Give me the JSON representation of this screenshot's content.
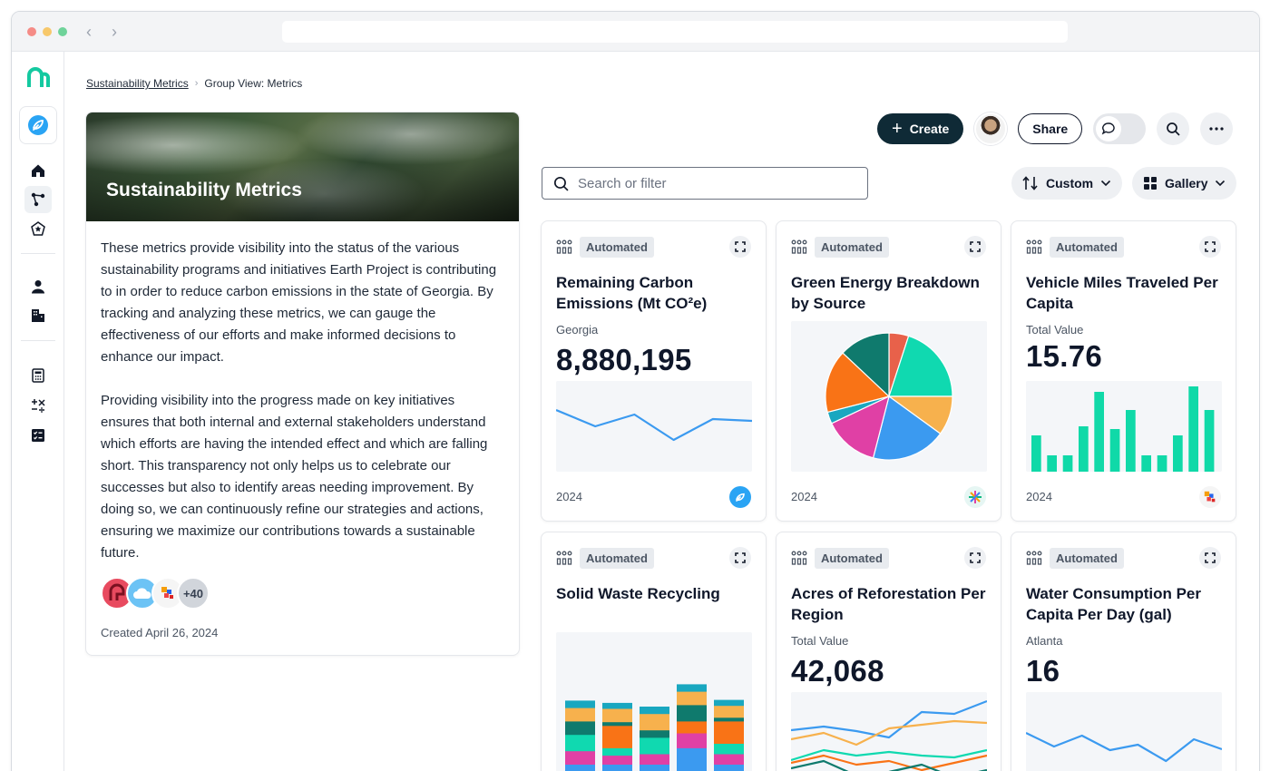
{
  "breadcrumb": {
    "root": "Sustainability Metrics",
    "current": "Group View: Metrics"
  },
  "about": {
    "title": "Sustainability Metrics",
    "paragraph1": "These metrics provide visibility into the status of the various sustainability programs and initiatives Earth Project is contributing to in order to reduce carbon emissions in the state of Georgia. By tracking and analyzing these metrics, we can gauge the effectiveness of our efforts and make informed decisions to enhance our impact.",
    "paragraph2": "Providing visibility into the progress made on key initiatives ensures that both internal and external stakeholders understand which efforts are having the intended effect and which are falling short. This transparency not only helps us to celebrate our successes but also to identify areas needing improvement. By doing so, we can continuously refine our strategies and actions, ensuring we maximize our contributions towards a sustainable future.",
    "more_count": "+40",
    "created": "Created April 26, 2024"
  },
  "toolbar": {
    "create": "Create",
    "share": "Share"
  },
  "search": {
    "placeholder": "Search or filter"
  },
  "sort": {
    "label": "Custom"
  },
  "view": {
    "label": "Gallery"
  },
  "colors": {
    "accent": "#0f2a36",
    "teal": "#10d9a8",
    "blue": "#3b9af0"
  },
  "cards": [
    {
      "badge": "Automated",
      "title": "Remaining Carbon Emissions (Mt CO²e)",
      "subtitle": "Georgia",
      "value": "8,880,195",
      "year": "2024"
    },
    {
      "badge": "Automated",
      "title": "Green Energy Breakdown by Source",
      "year": "2024"
    },
    {
      "badge": "Automated",
      "title": "Vehicle Miles Traveled Per Capita",
      "subtitle": "Total Value",
      "value": "15.76",
      "year": "2024"
    },
    {
      "badge": "Automated",
      "title": "Solid Waste Recycling"
    },
    {
      "badge": "Automated",
      "title": "Acres of Reforestation Per Region",
      "subtitle": "Total Value",
      "value": "42,068"
    },
    {
      "badge": "Automated",
      "title": "Water Consumption  Per Capita Per Day (gal)",
      "subtitle": "Atlanta",
      "value": "16"
    }
  ],
  "chart_data": [
    {
      "type": "line",
      "card": "Remaining Carbon Emissions (Mt CO²e)",
      "series": [
        {
          "color": "#3b9af0",
          "values": [
            68,
            50,
            63,
            35,
            58,
            56
          ]
        }
      ],
      "ylim": [
        0,
        100
      ]
    },
    {
      "type": "pie",
      "card": "Green Energy Breakdown by Source",
      "slices": [
        {
          "value": 5,
          "color": "#e8614a"
        },
        {
          "value": 20,
          "color": "#10d9b0"
        },
        {
          "value": 10,
          "color": "#f7b14d"
        },
        {
          "value": 19,
          "color": "#3b9af0"
        },
        {
          "value": 14,
          "color": "#e040a5"
        },
        {
          "value": 3,
          "color": "#19a7c0"
        },
        {
          "value": 16,
          "color": "#f97316"
        },
        {
          "value": 13,
          "color": "#0f7a6d"
        }
      ]
    },
    {
      "type": "bar",
      "card": "Vehicle Miles Traveled Per Capita",
      "values": [
        40,
        18,
        18,
        50,
        88,
        47,
        68,
        18,
        18,
        40,
        94,
        68
      ],
      "color": "#10d9a8",
      "ylim": [
        0,
        100
      ]
    },
    {
      "type": "bar",
      "stacked": true,
      "card": "Solid Waste Recycling",
      "stacks": [
        [
          {
            "value": 22,
            "color": "#3b9af0"
          },
          {
            "value": 18,
            "color": "#e040a5"
          },
          {
            "value": 22,
            "color": "#10d9b0"
          },
          {
            "value": 18,
            "color": "#0f7a6d"
          },
          {
            "value": 18,
            "color": "#f7b14d"
          },
          {
            "value": 10,
            "color": "#19a7c0"
          }
        ],
        [
          {
            "value": 22,
            "color": "#3b9af0"
          },
          {
            "value": 12,
            "color": "#e040a5"
          },
          {
            "value": 10,
            "color": "#10d9b0"
          },
          {
            "value": 30,
            "color": "#f97316"
          },
          {
            "value": 5,
            "color": "#0f7a6d"
          },
          {
            "value": 18,
            "color": "#f7b14d"
          },
          {
            "value": 8,
            "color": "#19a7c0"
          }
        ],
        [
          {
            "value": 22,
            "color": "#3b9af0"
          },
          {
            "value": 14,
            "color": "#e040a5"
          },
          {
            "value": 22,
            "color": "#10d9b0"
          },
          {
            "value": 10,
            "color": "#0f7a6d"
          },
          {
            "value": 22,
            "color": "#f7b14d"
          },
          {
            "value": 10,
            "color": "#19a7c0"
          }
        ],
        [
          {
            "value": 44,
            "color": "#3b9af0"
          },
          {
            "value": 20,
            "color": "#e040a5"
          },
          {
            "value": 16,
            "color": "#f97316"
          },
          {
            "value": 22,
            "color": "#0f7a6d"
          },
          {
            "value": 18,
            "color": "#f7b14d"
          },
          {
            "value": 10,
            "color": "#19a7c0"
          }
        ],
        [
          {
            "value": 22,
            "color": "#3b9af0"
          },
          {
            "value": 14,
            "color": "#e040a5"
          },
          {
            "value": 14,
            "color": "#10d9b0"
          },
          {
            "value": 30,
            "color": "#f97316"
          },
          {
            "value": 5,
            "color": "#0f7a6d"
          },
          {
            "value": 16,
            "color": "#f7b14d"
          },
          {
            "value": 8,
            "color": "#19a7c0"
          }
        ]
      ]
    },
    {
      "type": "line",
      "card": "Acres of Reforestation Per Region",
      "series": [
        {
          "color": "#3b9af0",
          "values": [
            58,
            62,
            57,
            50,
            78,
            76,
            90
          ]
        },
        {
          "color": "#f7b14d",
          "values": [
            48,
            55,
            42,
            60,
            64,
            68,
            66
          ]
        },
        {
          "color": "#10d9b0",
          "values": [
            25,
            36,
            30,
            34,
            30,
            28,
            36
          ]
        },
        {
          "color": "#f97316",
          "values": [
            22,
            30,
            20,
            24,
            14,
            22,
            30
          ]
        },
        {
          "color": "#0f7a6d",
          "values": [
            16,
            24,
            8,
            12,
            20,
            6,
            14
          ]
        }
      ],
      "ylim": [
        0,
        100
      ]
    },
    {
      "type": "line",
      "card": "Water Consumption  Per Capita Per Day (gal)",
      "series": [
        {
          "color": "#3b9af0",
          "values": [
            55,
            40,
            52,
            36,
            42,
            24,
            48,
            37
          ]
        }
      ],
      "ylim": [
        0,
        100
      ]
    }
  ]
}
